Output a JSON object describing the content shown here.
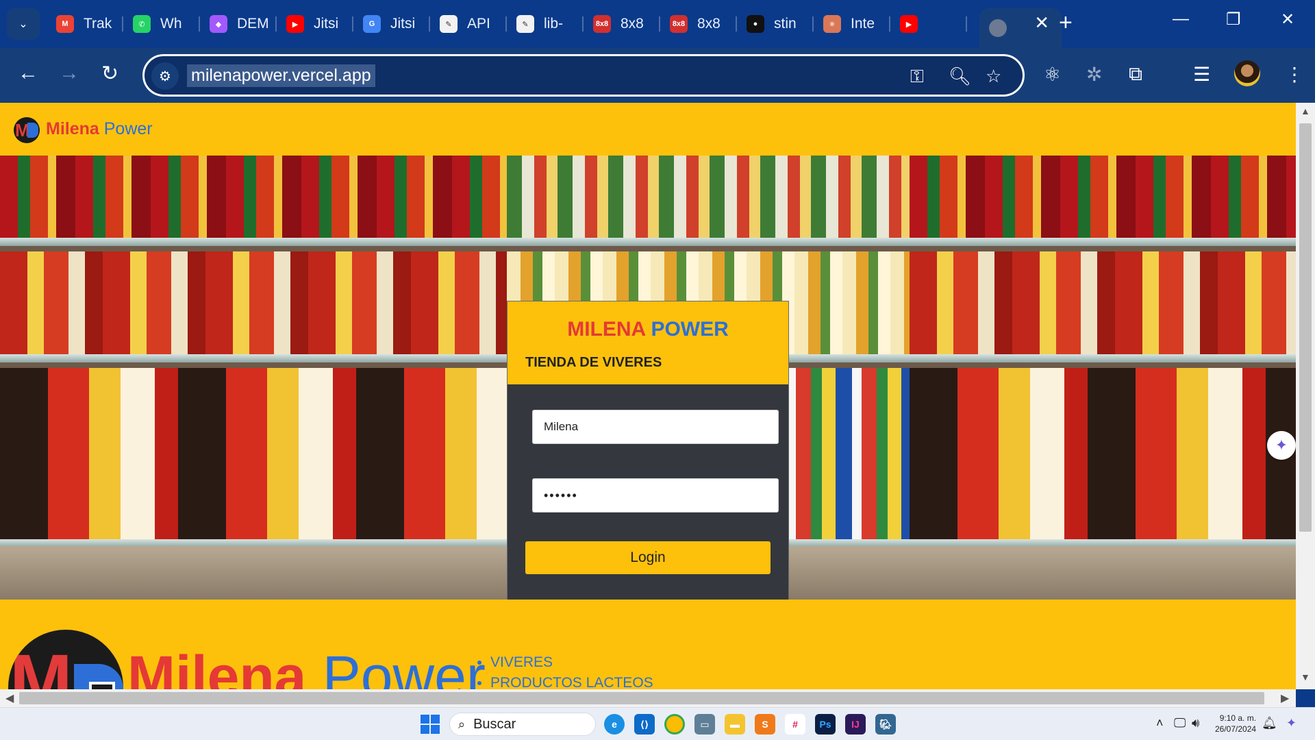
{
  "browser": {
    "tabs": [
      {
        "label": "Trak",
        "icon": "gmail-icon",
        "color": "#ea4335",
        "glyph": "M"
      },
      {
        "label": "Wh",
        "icon": "whatsapp-icon",
        "color": "#25d366",
        "glyph": "✆"
      },
      {
        "label": "DEM",
        "icon": "figma-icon",
        "color": "#a259ff",
        "glyph": "◆"
      },
      {
        "label": "Jitsi",
        "icon": "youtube-icon",
        "color": "#ff0000",
        "glyph": "▶"
      },
      {
        "label": "Jitsi",
        "icon": "google-icon",
        "color": "#4285f4",
        "glyph": "G"
      },
      {
        "label": "API",
        "icon": "document-icon",
        "color": "#f2f2f2",
        "glyph": "✎"
      },
      {
        "label": "lib-",
        "icon": "document-icon",
        "color": "#f2f2f2",
        "glyph": "✎"
      },
      {
        "label": "8x8",
        "icon": "8x8-icon",
        "color": "#d32f2f",
        "glyph": "8x8"
      },
      {
        "label": "8x8",
        "icon": "8x8-icon",
        "color": "#d32f2f",
        "glyph": "8x8"
      },
      {
        "label": "stin",
        "icon": "github-icon",
        "color": "#111111",
        "glyph": "●"
      },
      {
        "label": "Inte",
        "icon": "claude-icon",
        "color": "#d97757",
        "glyph": "✳"
      },
      {
        "label": "",
        "icon": "youtube-audio-icon",
        "color": "#ff0000",
        "glyph": "▶"
      }
    ],
    "url": "milenapower.vercel.app"
  },
  "header": {
    "brand_first": "Milena",
    "brand_second": "Power"
  },
  "login": {
    "title_first": "MILENA",
    "title_second": "POWER",
    "subtitle": "TIENDA DE VIVERES",
    "username_value": "Milena",
    "password_value": "••••••",
    "button_label": "Login"
  },
  "footer": {
    "brand_first": "Milena",
    "brand_second": "Power",
    "links": [
      "VIVERES",
      "PRODUCTOS LACTEOS"
    ]
  },
  "taskbar": {
    "search_placeholder": "Buscar",
    "time": "9:10 a. m.",
    "date": "26/07/2024"
  }
}
